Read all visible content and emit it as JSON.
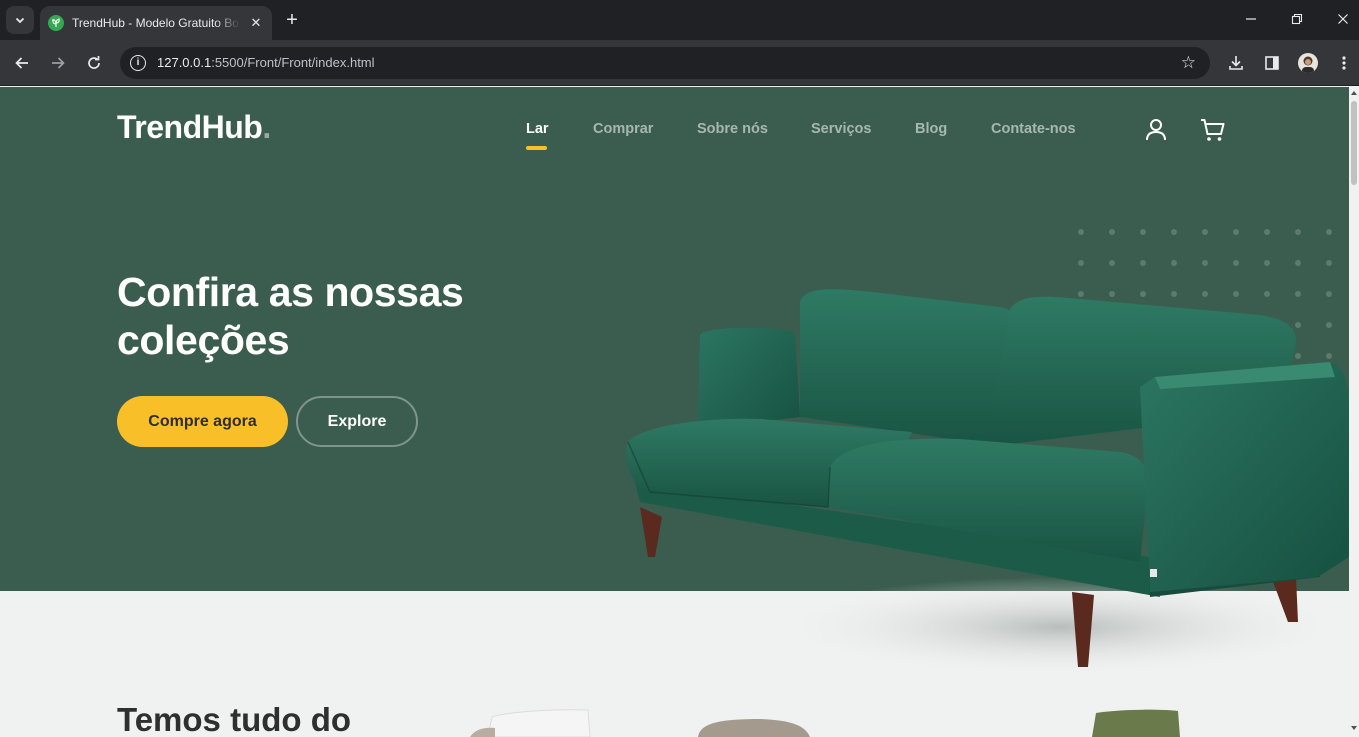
{
  "browser": {
    "tab_title": "TrendHub - Modelo Gratuito Bootstrap",
    "url_host": "127.0.0.1",
    "url_rest": ":5500/Front/Front/index.html"
  },
  "site": {
    "logo_text": "TrendHub",
    "logo_dot": ".",
    "nav": [
      {
        "label": "Lar"
      },
      {
        "label": "Comprar"
      },
      {
        "label": "Sobre nós"
      },
      {
        "label": "Serviços"
      },
      {
        "label": "Blog"
      },
      {
        "label": "Contate-nos"
      }
    ],
    "active_nav": "Lar",
    "accent_color": "#f9bf29",
    "hero_bg": "#3b5d50"
  },
  "hero": {
    "title_line1": "Confira as nossas",
    "title_line2": "coleções",
    "primary_button": "Compre agora",
    "secondary_button": "Explore"
  },
  "section": {
    "title": "Temos tudo do"
  },
  "icons": {
    "user": "user-icon",
    "cart": "cart-icon"
  }
}
